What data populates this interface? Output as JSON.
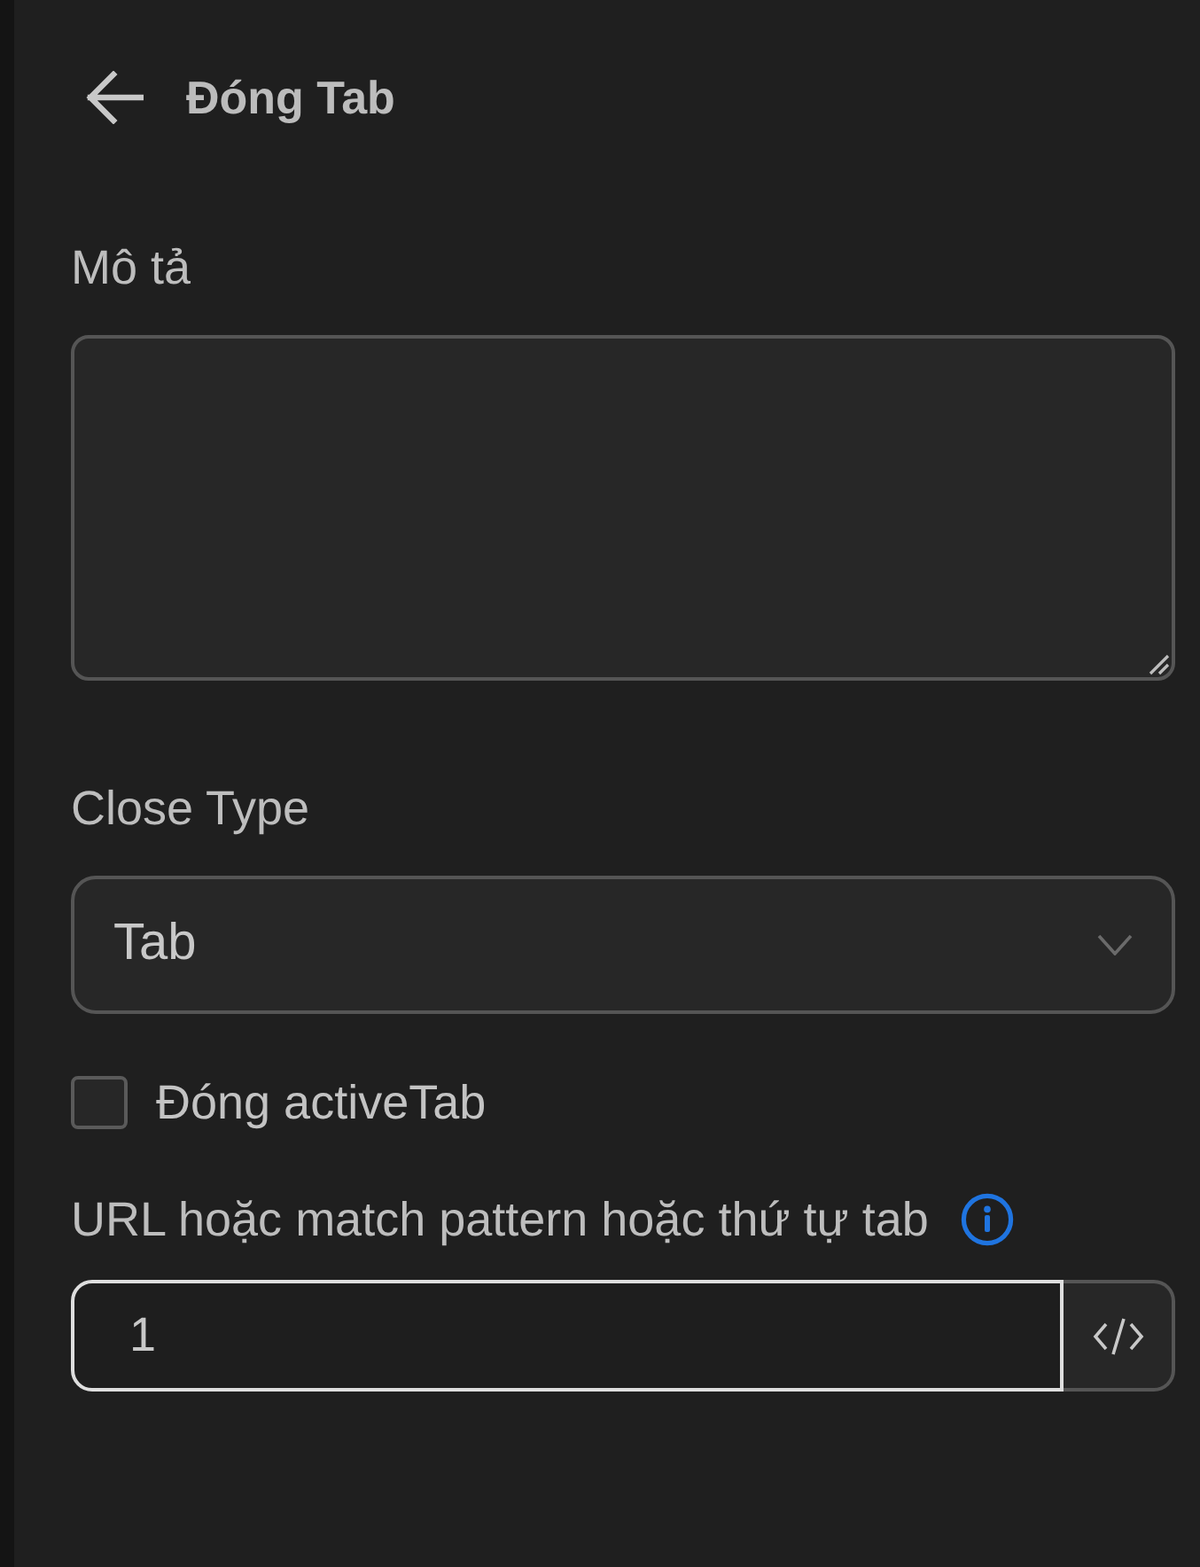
{
  "header": {
    "title": "Đóng Tab"
  },
  "description": {
    "label": "Mô tả"
  },
  "close_type": {
    "label": "Close Type",
    "value": "Tab"
  },
  "close_active_tab": {
    "label": "Đóng activeTab",
    "checked": false
  },
  "url_field": {
    "label": "URL hoặc match pattern hoặc thứ tự tab",
    "value": "1",
    "focused": true
  }
}
